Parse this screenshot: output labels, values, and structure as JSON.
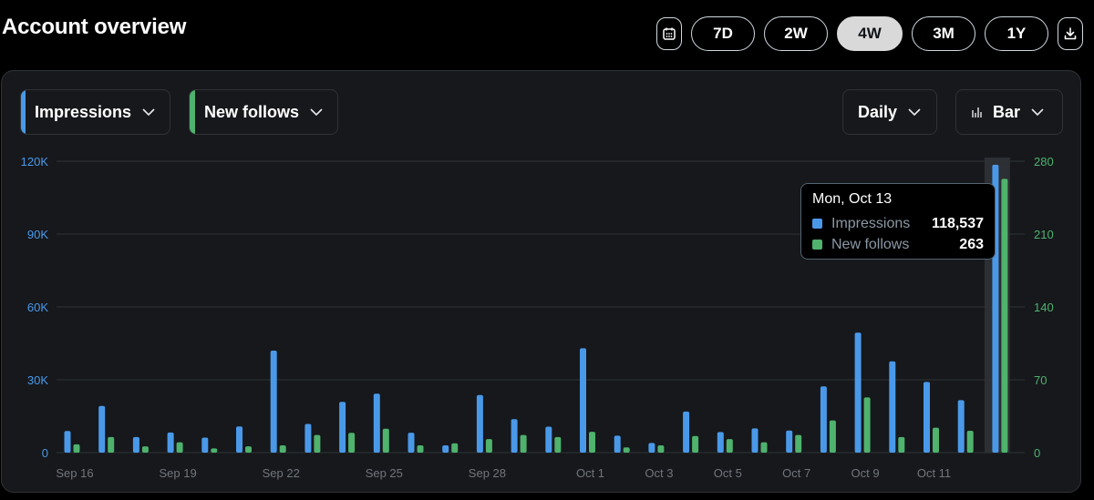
{
  "header": {
    "title": "Account overview",
    "ranges": [
      "7D",
      "2W",
      "4W",
      "3M",
      "1Y"
    ],
    "active_range": "4W"
  },
  "controls": {
    "metric_primary": "Impressions",
    "metric_secondary": "New follows",
    "interval": "Daily",
    "chart_type": "Bar"
  },
  "colors": {
    "impressions": "#4a99e9",
    "new_follows": "#4fb26d",
    "grid": "#2f3336",
    "axis_text": "#71767b"
  },
  "tooltip": {
    "date": "Mon, Oct 13",
    "rows": [
      {
        "name": "Impressions",
        "value": "118,537",
        "color": "#4a99e9"
      },
      {
        "name": "New follows",
        "value": "263",
        "color": "#4fb26d"
      }
    ]
  },
  "chart_data": {
    "type": "bar",
    "categories": [
      "Sep 16",
      "Sep 17",
      "Sep 18",
      "Sep 19",
      "Sep 20",
      "Sep 21",
      "Sep 22",
      "Sep 23",
      "Sep 24",
      "Sep 25",
      "Sep 26",
      "Sep 27",
      "Sep 28",
      "Sep 29",
      "Sep 30",
      "Oct 1",
      "Oct 2",
      "Oct 3",
      "Oct 4",
      "Oct 5",
      "Oct 6",
      "Oct 7",
      "Oct 8",
      "Oct 9",
      "Oct 10",
      "Oct 11",
      "Oct 12",
      "Oct 13"
    ],
    "tick_labels": [
      "Sep 16",
      "",
      "",
      "Sep 19",
      "",
      "",
      "Sep 22",
      "",
      "",
      "Sep 25",
      "",
      "",
      "Sep 28",
      "",
      "",
      "Oct 1",
      "",
      "Oct 3",
      "",
      "Oct 5",
      "",
      "Oct 7",
      "",
      "Oct 9",
      "",
      "Oct 11",
      "",
      ""
    ],
    "series": [
      {
        "name": "Impressions",
        "axis": "left",
        "values": [
          8900,
          19200,
          6400,
          8300,
          6200,
          10800,
          42000,
          11800,
          20900,
          24300,
          8200,
          3000,
          23700,
          13800,
          10700,
          43000,
          7000,
          4000,
          16900,
          8500,
          10000,
          9100,
          27300,
          49400,
          37600,
          29100,
          21600,
          118537
        ]
      },
      {
        "name": "New follows",
        "axis": "right",
        "values": [
          8,
          15,
          6,
          10,
          4,
          6,
          7,
          17,
          19,
          23,
          7,
          9,
          13,
          17,
          15,
          20,
          5,
          7,
          16,
          13,
          10,
          17,
          31,
          53,
          15,
          24,
          21,
          263
        ]
      }
    ],
    "left_axis": {
      "ticks": [
        "0",
        "30K",
        "60K",
        "90K",
        "120K"
      ],
      "range": [
        0,
        120000
      ]
    },
    "right_axis": {
      "ticks": [
        "0",
        "70",
        "140",
        "210",
        "280"
      ],
      "range": [
        0,
        280
      ]
    },
    "highlighted_index": 27,
    "grid": true
  }
}
